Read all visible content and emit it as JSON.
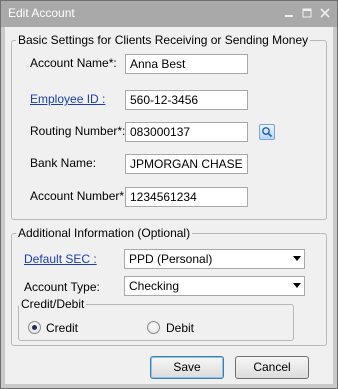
{
  "window": {
    "title": "Edit Account"
  },
  "basic": {
    "legend": "Basic Settings for Clients Receiving or Sending Money",
    "account_name_label": "Account Name*:",
    "account_name_value": "Anna Best",
    "employee_id_label": "Employee ID :",
    "employee_id_value": "560-12-3456",
    "routing_label": "Routing Number*:",
    "routing_value": "083000137",
    "bank_name_label": "Bank Name:",
    "bank_name_value": "JPMORGAN CHASE BA",
    "account_number_label": "Account Number*:",
    "account_number_value": "1234561234"
  },
  "additional": {
    "legend": "Additional Information (Optional)",
    "default_sec_label": "Default SEC :",
    "default_sec_value": "PPD (Personal)",
    "account_type_label": "Account Type:",
    "account_type_value": "Checking",
    "credit_debit_legend": "Credit/Debit",
    "credit_label": "Credit",
    "debit_label": "Debit",
    "selected": "Credit"
  },
  "buttons": {
    "save": "Save",
    "cancel": "Cancel"
  },
  "icons": [
    "minimize-icon",
    "maximize-icon",
    "close-icon",
    "search-icon"
  ]
}
